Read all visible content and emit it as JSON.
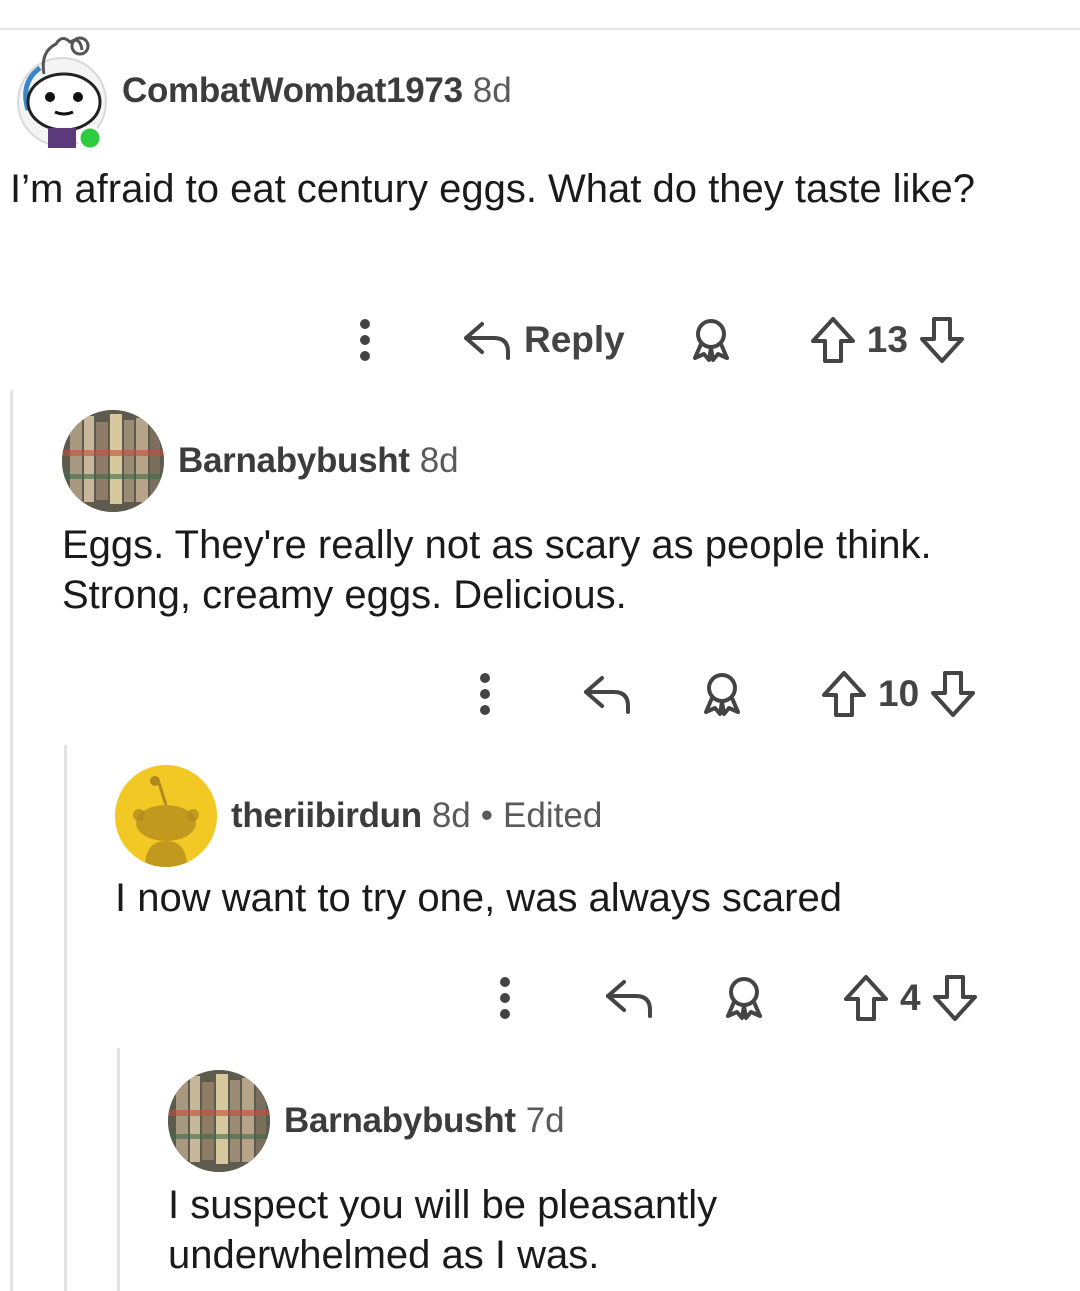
{
  "comments": [
    {
      "username": "CombatWombat1973",
      "age": "8d",
      "text": "I’m afraid to eat century eggs. What do they taste like?",
      "reply_label": "Reply",
      "score": "13"
    },
    {
      "username": "Barnabybusht",
      "age": "8d",
      "text": "Eggs. They're really not as scary as people think. Strong, creamy eggs. Delicious.",
      "score": "10"
    },
    {
      "username": "theriibirdun",
      "age": "8d",
      "separator": "•",
      "edited": "Edited",
      "text": "I now want to try one, was always scared",
      "score": "4"
    },
    {
      "username": "Barnabybusht",
      "age": "7d",
      "text": "I suspect you will be pleasantly underwhelmed as I was."
    }
  ],
  "colors": {
    "online_dot": "#2ecc40",
    "snoo_yellow": "#f2c824",
    "thread_line": "#e3e3e3",
    "meta_text": "#5a5a5a"
  }
}
